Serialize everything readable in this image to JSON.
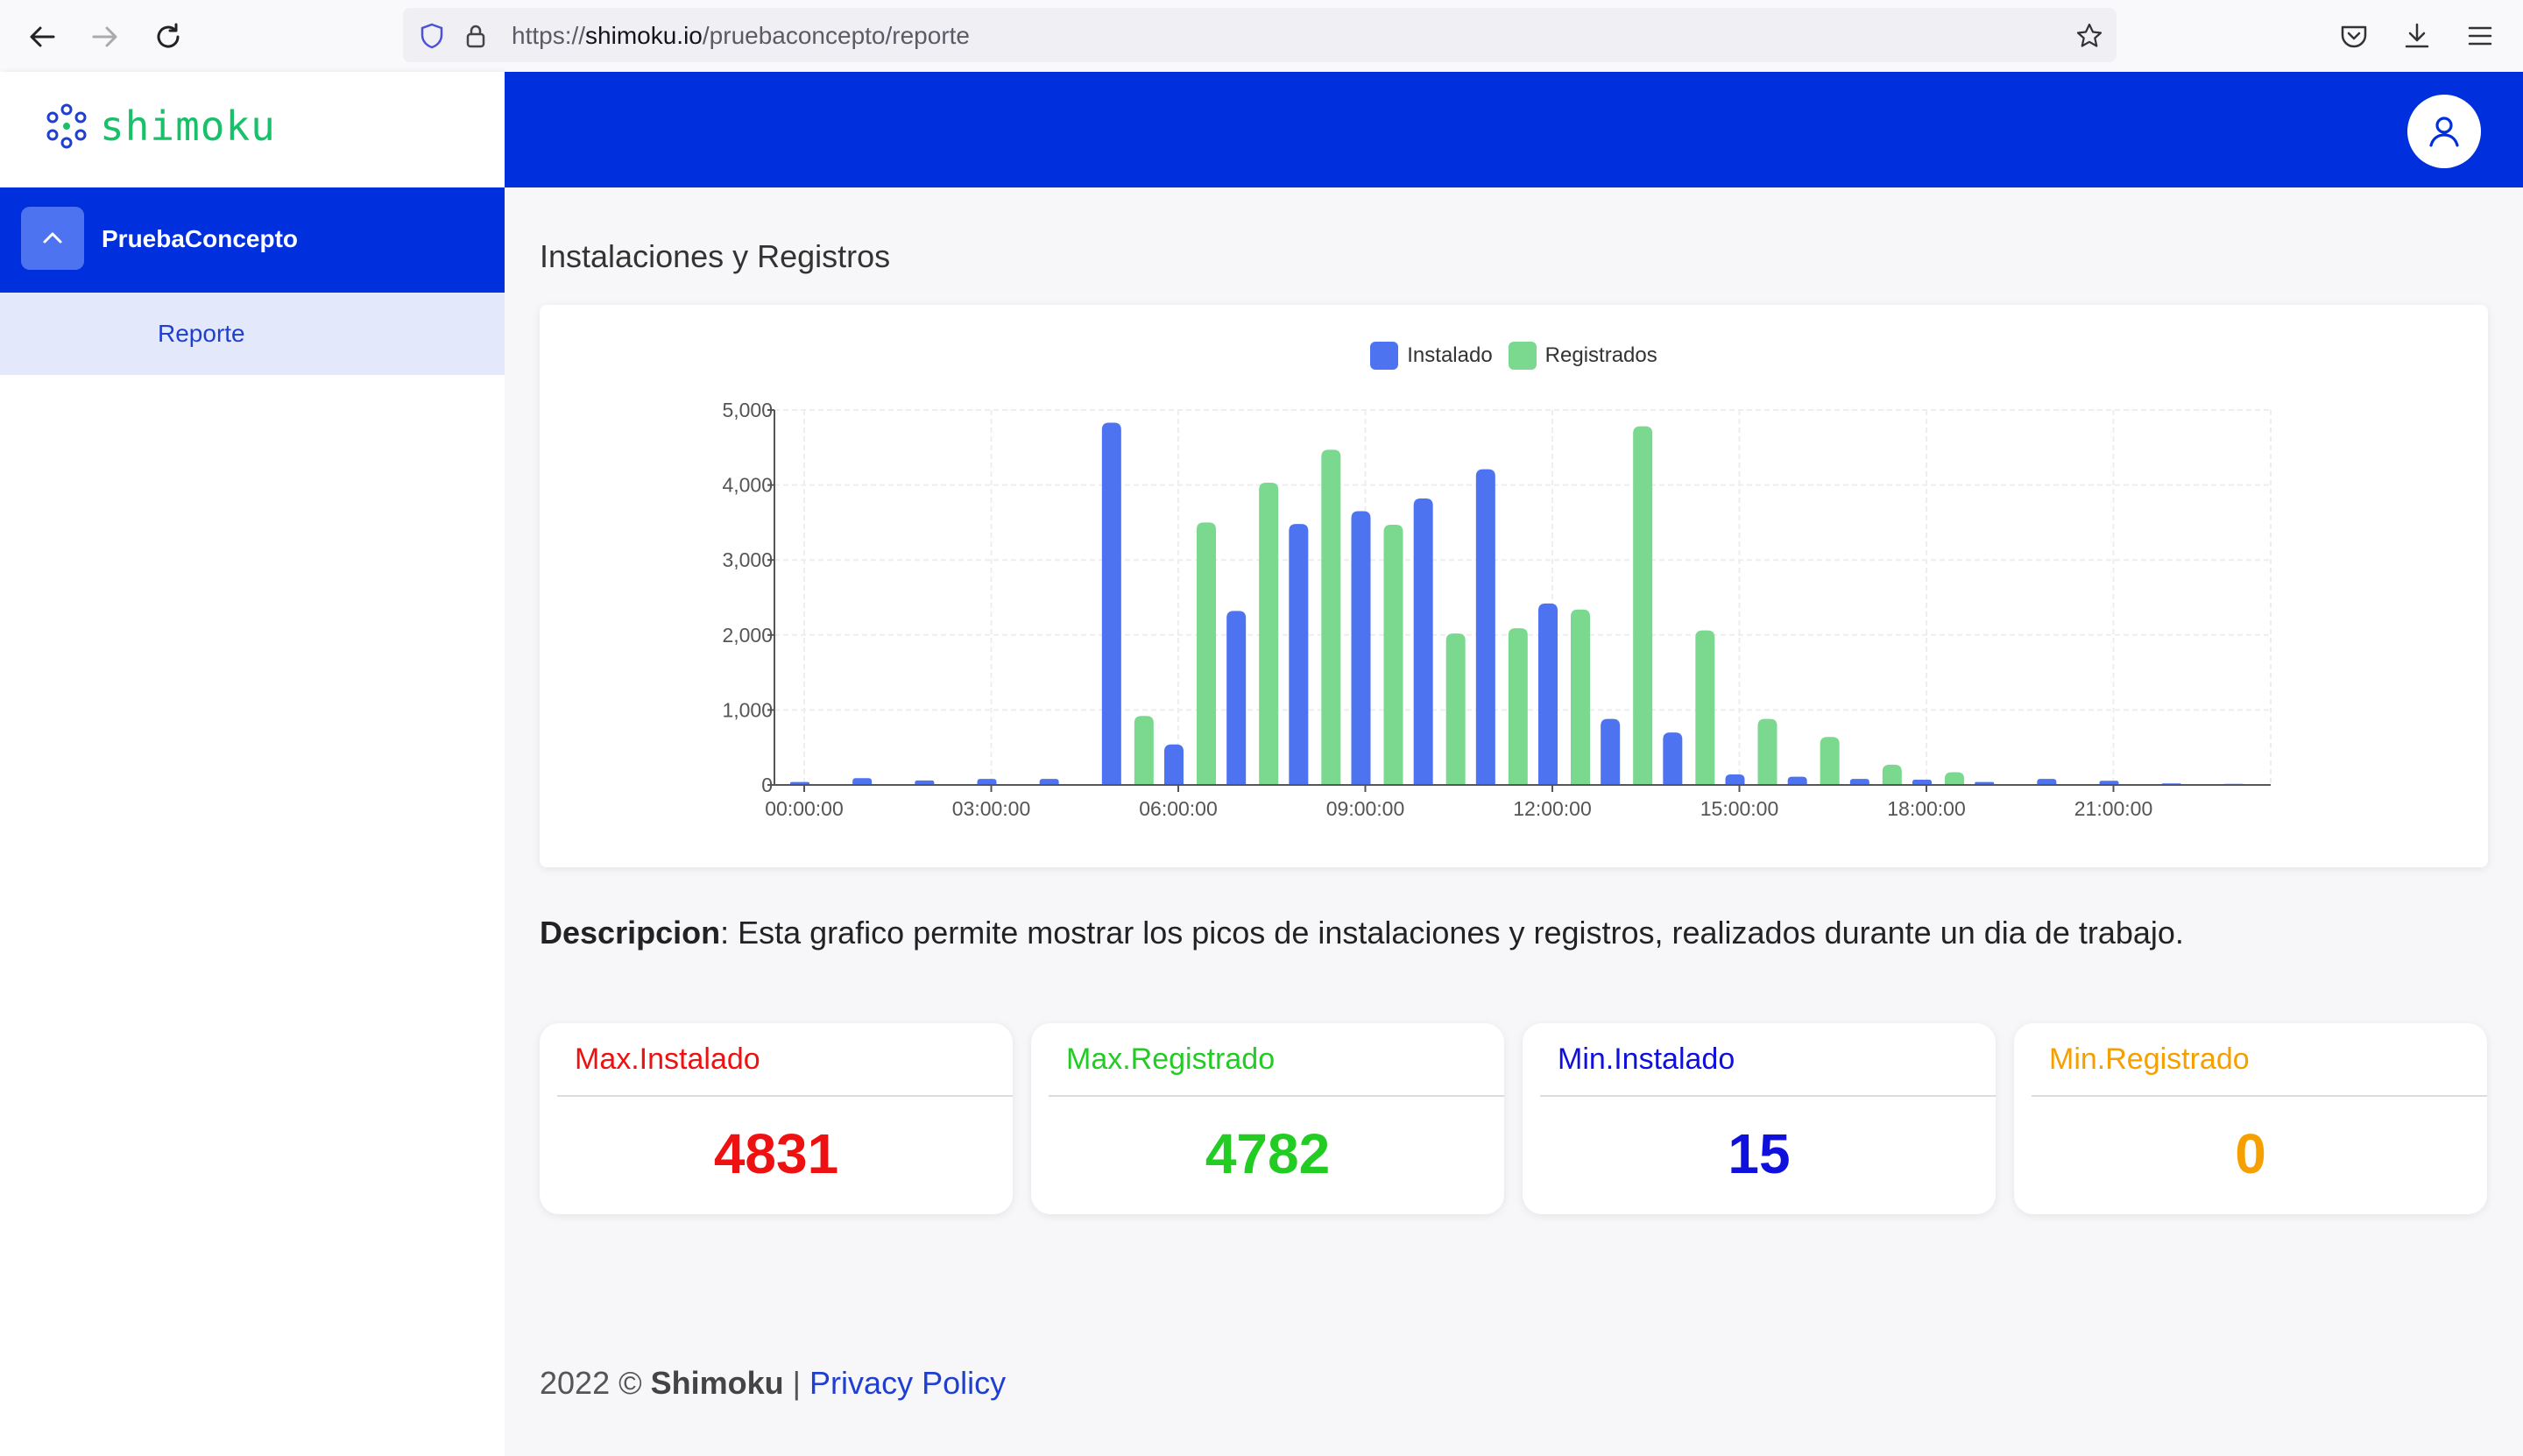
{
  "browser": {
    "url_scheme": "https://",
    "url_host": "shimoku.io",
    "url_path": "/pruebaconcepto/reporte"
  },
  "sidebar": {
    "logo_text": "shimoku",
    "group": {
      "label": "PruebaConcepto",
      "expanded": true
    },
    "items": [
      {
        "label": "Reporte",
        "active": true
      }
    ]
  },
  "main": {
    "section_title": "Instalaciones y Registros",
    "description_label": "Descripcion",
    "description_text": ": Esta grafico permite mostrar los picos de instalaciones y registros, realizados durante un dia de trabajo."
  },
  "kpis": [
    {
      "title": "Max.Instalado",
      "value": "4831",
      "color": "#ee1111"
    },
    {
      "title": "Max.Registrado",
      "value": "4782",
      "color": "#22cc22"
    },
    {
      "title": "Min.Instalado",
      "value": "15",
      "color": "#1010dd"
    },
    {
      "title": "Min.Registrado",
      "value": "0",
      "color": "#f5a000"
    }
  ],
  "footer": {
    "year": "2022 ©",
    "brand": "Shimoku",
    "separator": "|",
    "link": "Privacy Policy"
  },
  "colors": {
    "brand_blue": "#0030dd",
    "instalado": "#4e73f0",
    "registrados": "#7ad98f"
  },
  "chart_data": {
    "type": "bar",
    "title": "Instalaciones y Registros",
    "x_tick_labels": [
      "00:00:00",
      "03:00:00",
      "06:00:00",
      "09:00:00",
      "12:00:00",
      "15:00:00",
      "18:00:00",
      "21:00:00"
    ],
    "y_tick_labels": [
      "0",
      "1,000",
      "2,000",
      "3,000",
      "4,000",
      "5,000"
    ],
    "ylim": [
      0,
      5000
    ],
    "grid": true,
    "legend_position": "top-center",
    "categories": [
      "00:00:00",
      "01:00:00",
      "02:00:00",
      "03:00:00",
      "04:00:00",
      "05:00:00",
      "06:00:00",
      "07:00:00",
      "08:00:00",
      "09:00:00",
      "10:00:00",
      "11:00:00",
      "12:00:00",
      "13:00:00",
      "14:00:00",
      "15:00:00",
      "16:00:00",
      "17:00:00",
      "18:00:00",
      "19:00:00",
      "20:00:00",
      "21:00:00",
      "22:00:00",
      "23:00:00"
    ],
    "series": [
      {
        "name": "Instalado",
        "color": "#4e73f0",
        "values": [
          40,
          90,
          60,
          80,
          80,
          4831,
          540,
          2320,
          3480,
          3650,
          3820,
          4210,
          2420,
          880,
          700,
          140,
          110,
          80,
          70,
          40,
          80,
          55,
          20,
          15
        ]
      },
      {
        "name": "Registrados",
        "color": "#7ad98f",
        "values": [
          0,
          0,
          0,
          0,
          0,
          920,
          3500,
          4030,
          4470,
          3470,
          2020,
          2090,
          2340,
          4782,
          2060,
          880,
          640,
          270,
          170,
          0,
          0,
          0,
          0,
          0
        ]
      }
    ]
  }
}
